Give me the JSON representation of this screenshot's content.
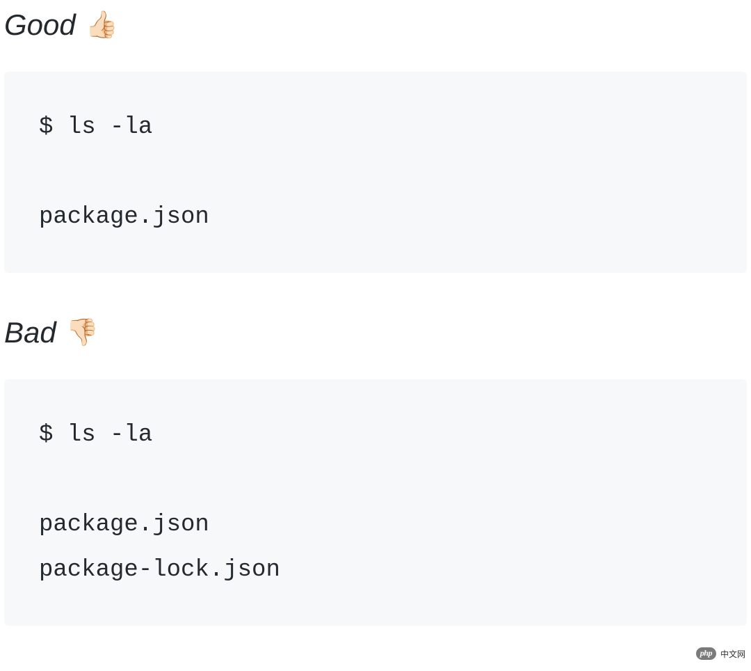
{
  "sections": {
    "good": {
      "label": "Good",
      "emoji": "👍🏻",
      "code": "$ ls -la\n\npackage.json"
    },
    "bad": {
      "label": "Bad",
      "emoji": "👎🏻",
      "code": "$ ls -la\n\npackage.json\npackage-lock.json"
    }
  },
  "watermark": {
    "badge": "php",
    "text": "中文网"
  }
}
